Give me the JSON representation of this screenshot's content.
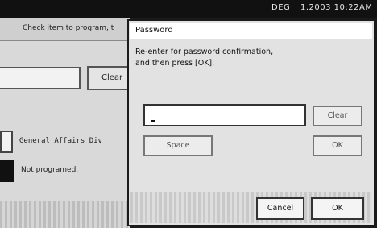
{
  "status_bar": {
    "mode": "DEG",
    "time": "1.2003 10:22AM"
  },
  "background": {
    "instruction": "Check item to program, t",
    "clear_label": "Clear",
    "name_value": "General Affairs Div",
    "status_text": "Not programed."
  },
  "dialog": {
    "title": "Password",
    "message_line1": "Re-enter for password confirmation,",
    "message_line2": "and then press [OK].",
    "input_value": "",
    "clear_button": "Clear",
    "space_button": "Space",
    "ok_inline_button": "OK",
    "cancel_button": "Cancel",
    "ok_button": "OK"
  }
}
